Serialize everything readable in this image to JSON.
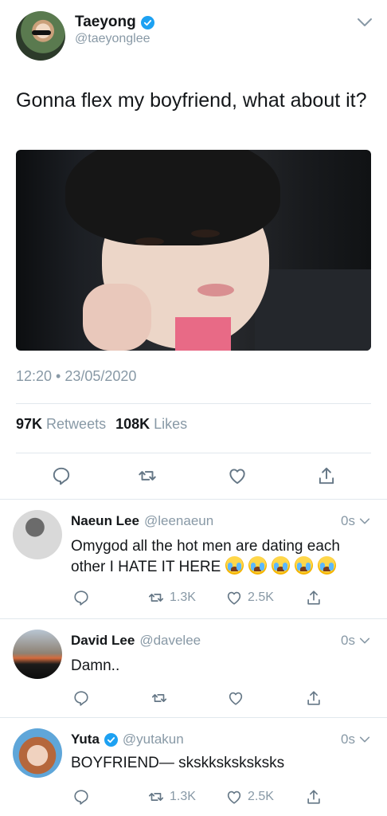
{
  "tweet": {
    "author_name": "Taeyong",
    "author_handle": "@taeyonglee",
    "text": "Gonna flex my boyfriend, what about it?",
    "timestamp": "12:20 • 23/05/2020",
    "retweets_count": "97K",
    "retweets_label": "Retweets",
    "likes_count": "108K",
    "likes_label": "Likes"
  },
  "replies": [
    {
      "name": "Naeun Lee",
      "handle": "@leenaeun",
      "time": "0s",
      "text": "Omygod all the hot men are dating each other I HATE IT HERE",
      "emoji": "😭",
      "emoji_count": 5,
      "retweets": "1.3K",
      "likes": "2.5K"
    },
    {
      "name": "David Lee",
      "handle": "@davelee",
      "time": "0s",
      "text": "Damn..",
      "retweets": "",
      "likes": ""
    },
    {
      "name": "Yuta",
      "handle": "@yutakun",
      "time": "0s",
      "text": "BOYFRIEND— skskksksksksks",
      "retweets": "1.3K",
      "likes": "2.5K"
    }
  ],
  "colors": {
    "accent": "#1da1f2",
    "text": "#14171a",
    "muted": "#8899a6",
    "divider": "#e1e8ed"
  },
  "icons": [
    "verified-badge-icon",
    "chevron-down-icon",
    "reply-icon",
    "retweet-icon",
    "like-icon",
    "share-icon"
  ]
}
